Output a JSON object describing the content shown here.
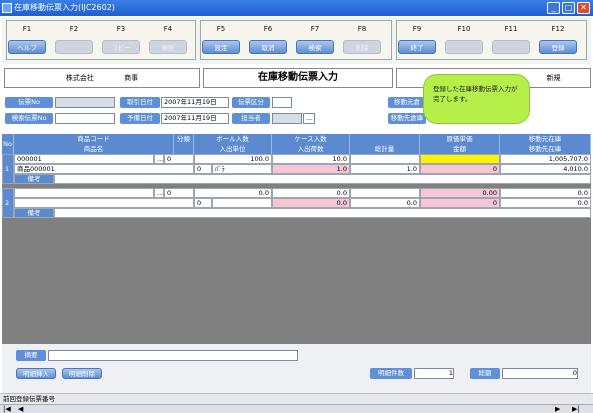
{
  "window": {
    "title": "在庫移動伝票入力(IJC2602)",
    "min": "_",
    "max": "□",
    "close": "✕"
  },
  "fkeys": [
    {
      "key": "F1",
      "label": "ヘルプ",
      "enabled": true
    },
    {
      "key": "F2",
      "label": "",
      "enabled": false
    },
    {
      "key": "F3",
      "label": "コピー",
      "enabled": false
    },
    {
      "key": "F4",
      "label": "参照",
      "enabled": false
    },
    {
      "key": "F5",
      "label": "設定",
      "enabled": true
    },
    {
      "key": "F6",
      "label": "取消",
      "enabled": true
    },
    {
      "key": "F7",
      "label": "検索",
      "enabled": true
    },
    {
      "key": "F8",
      "label": "削除",
      "enabled": false
    },
    {
      "key": "F9",
      "label": "終了",
      "enabled": true
    },
    {
      "key": "F10",
      "label": "",
      "enabled": false
    },
    {
      "key": "F11",
      "label": "",
      "enabled": false
    },
    {
      "key": "F12",
      "label": "登録",
      "enabled": true
    }
  ],
  "header": {
    "company": "株式会社",
    "dept": "商事",
    "title": "在庫移動伝票入力",
    "mode": "新規"
  },
  "form": {
    "slip_no_label": "伝票No",
    "slip_no": "",
    "trans_date_label": "取引日付",
    "trans_date": "2007年11月19日",
    "slip_type_label": "伝票区分",
    "slip_type": "",
    "search_no_label": "検索伝票No",
    "search_no": "",
    "plan_date_label": "予備日付",
    "plan_date": "2007年11月19日",
    "person_label": "担当者",
    "person": "",
    "person_btn": "...",
    "dest_label1": "移動元倉",
    "dest_label2": "移動先倉庫"
  },
  "tooltip": "登録した在庫移動伝票入力が完了します。",
  "grid": {
    "headers": {
      "no": "No",
      "code": "商品コード",
      "name": "商品名",
      "bunrui": "分類",
      "bara": "ボール入数",
      "bara2": "入出単位",
      "case": "ケース入数",
      "case2": "入出荷数",
      "total": "総計量",
      "price": "原価単価",
      "amount": "金額",
      "stock_from": "移動元在庫",
      "stock_to": "移動先在庫"
    },
    "rows": [
      {
        "no": "1",
        "code": "000001",
        "bunrui": "0",
        "bara": "100.0",
        "case": "10.0",
        "price": "",
        "stock_from": "1,005,707.0",
        "name": "商品000001",
        "unit_sel": "0",
        "unit": "ﾊﾞﾗ",
        "case_qty": "1.0",
        "total": "1.0",
        "amount": "0",
        "stock_to": "4,010.0",
        "memo_label": "備考",
        "memo": ""
      },
      {
        "no": "2",
        "code": "",
        "bunrui": "0",
        "bara": "0.0",
        "case": "0.0",
        "price": "0.00",
        "stock_from": "0.0",
        "name": "",
        "unit_sel": "0",
        "unit": "",
        "case_qty": "0.0",
        "total": "0.0",
        "amount": "0",
        "stock_to": "0.0",
        "memo_label": "備考",
        "memo": ""
      }
    ]
  },
  "footer": {
    "memo_label": "摘要",
    "memo": "",
    "insert_btn": "明細挿入",
    "delete_btn": "明細削除",
    "count_label": "明細件数",
    "count": "1",
    "total_label": "総額",
    "total": "0"
  },
  "status": {
    "text": "前回登録伝票番号"
  },
  "nav": {
    "first": "|◀",
    "prev": "◀",
    "next": "▶",
    "last": "▶|"
  }
}
